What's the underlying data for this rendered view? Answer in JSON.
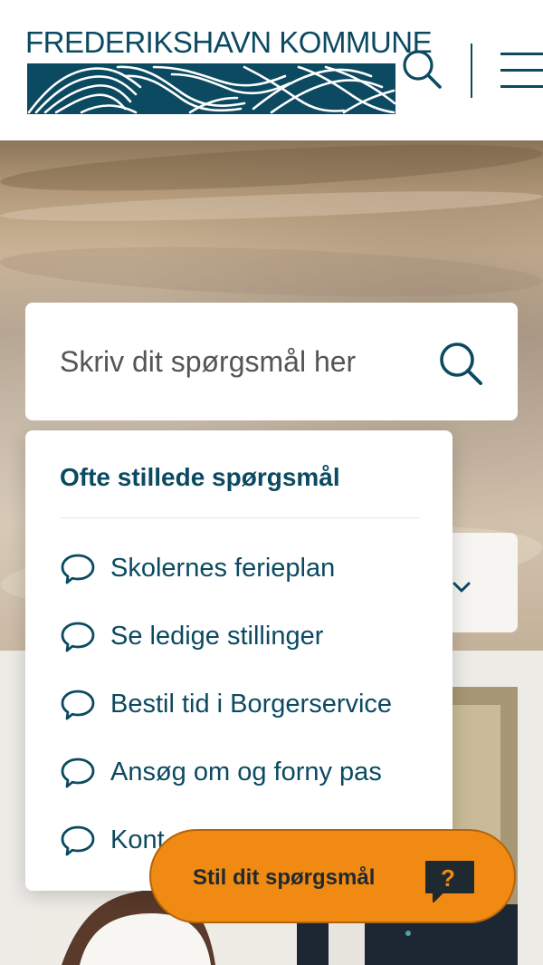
{
  "header": {
    "logo_text": "FREDERIKSHAVN KOMMUNE",
    "search_icon": "search-icon",
    "menu_icon": "menu-icon"
  },
  "search": {
    "placeholder": "Skriv dit spørgsmål her",
    "icon": "search-icon"
  },
  "faq": {
    "title": "Ofte stillede spørgsmål",
    "items": [
      {
        "label": "Skolernes ferieplan",
        "icon": "speech-bubble-icon"
      },
      {
        "label": "Se ledige stillinger",
        "icon": "speech-bubble-icon"
      },
      {
        "label": "Bestil tid i Borgerservice",
        "icon": "speech-bubble-icon"
      },
      {
        "label": "Ansøg om og forny pas",
        "icon": "speech-bubble-icon"
      },
      {
        "label": "Kont",
        "icon": "speech-bubble-icon"
      }
    ]
  },
  "ask_button": {
    "label": "Stil dit spørgsmål",
    "icon": "question-bubble-icon"
  },
  "colors": {
    "brand": "#0b4a61",
    "accent": "#f08a12",
    "background": "#ecebe6"
  }
}
